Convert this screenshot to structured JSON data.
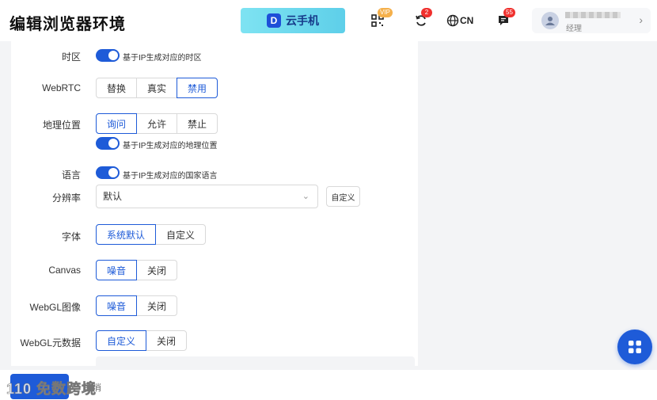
{
  "header": {
    "title": "编辑浏览器环境",
    "cloud_logo": "D",
    "cloud_label": "云手机",
    "qr_badge": "VIP",
    "sync_badge": "2",
    "language": "CN",
    "msg_badge": "55",
    "user_role": "经理"
  },
  "colors": {
    "accent": "#1e5bd8",
    "badge": "#f0302d"
  },
  "form": {
    "timezone": {
      "label": "时区",
      "toggle_text": "基于IP生成对应的时区",
      "enabled": true
    },
    "webrtc": {
      "label": "WebRTC",
      "options": [
        "替换",
        "真实",
        "禁用"
      ],
      "selected": "禁用"
    },
    "geo": {
      "label": "地理位置",
      "options": [
        "询问",
        "允许",
        "禁止"
      ],
      "selected": "询问",
      "toggle_text": "基于IP生成对应的地理位置",
      "enabled": true
    },
    "language": {
      "label": "语言",
      "toggle_text": "基于IP生成对应的国家语言",
      "enabled": true
    },
    "resolution": {
      "label": "分辨率",
      "value": "默认",
      "custom_label": "自定义"
    },
    "font": {
      "label": "字体",
      "options": [
        "系统默认",
        "自定义"
      ],
      "selected": "系统默认"
    },
    "canvas": {
      "label": "Canvas",
      "options": [
        "噪音",
        "关闭"
      ],
      "selected": "噪音"
    },
    "webgl_image": {
      "label": "WebGL图像",
      "options": [
        "噪音",
        "关闭"
      ],
      "selected": "噪音"
    },
    "webgl_meta": {
      "label": "WebGL元数据",
      "options": [
        "自定义",
        "关闭"
      ],
      "selected": "自定义"
    }
  },
  "footer": {
    "cancel_label": "取消",
    "watermark": "110 免数跨境"
  }
}
